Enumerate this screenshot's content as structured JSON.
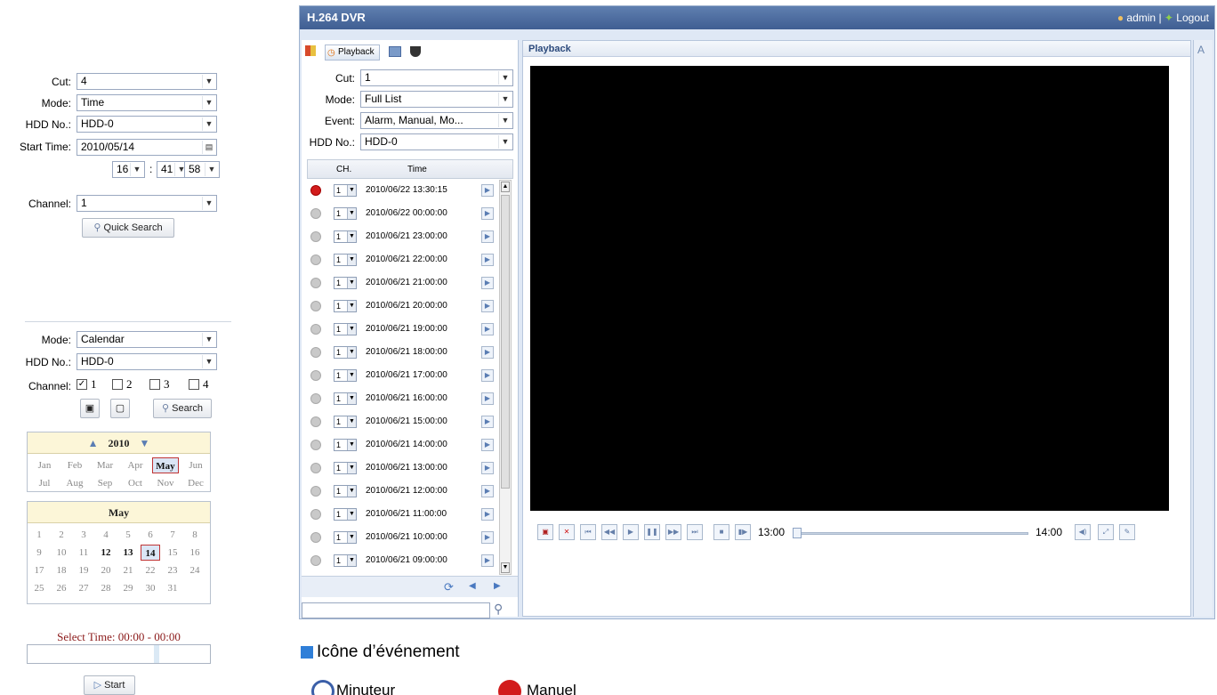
{
  "quick": {
    "cut_label": "Cut:",
    "cut_value": "4",
    "mode_label": "Mode:",
    "mode_value": "Time",
    "hdd_label": "HDD No.:",
    "hdd_value": "HDD-0",
    "start_label": "Start Time:",
    "start_value": "2010/05/14",
    "hour": "16",
    "minute": "41",
    "second": "58",
    "channel_label": "Channel:",
    "channel_value": "1",
    "search_button": "Quick Search"
  },
  "calsearch": {
    "mode_label": "Mode:",
    "mode_value": "Calendar",
    "hdd_label": "HDD No.:",
    "hdd_value": "HDD-0",
    "channel_label": "Channel:",
    "channels": [
      "1",
      "2",
      "3",
      "4"
    ],
    "channel_checked": [
      true,
      false,
      false,
      false
    ],
    "search_button": "Search",
    "year": "2010",
    "months": [
      "Jan",
      "Feb",
      "Mar",
      "Apr",
      "May",
      "Jun",
      "Jul",
      "Aug",
      "Sep",
      "Oct",
      "Nov",
      "Dec"
    ],
    "selected_month": "May",
    "month_title": "May",
    "days": [
      "1",
      "2",
      "3",
      "4",
      "5",
      "6",
      "7",
      "8",
      "9",
      "10",
      "11",
      "12",
      "13",
      "14",
      "15",
      "16",
      "17",
      "18",
      "19",
      "20",
      "21",
      "22",
      "23",
      "24",
      "25",
      "26",
      "27",
      "28",
      "29",
      "30",
      "31"
    ],
    "bold_days": [
      "12",
      "13",
      "14"
    ],
    "selected_day": "14",
    "select_time": "Select Time: 00:00 - 00:00",
    "start_button": "Start"
  },
  "dvr": {
    "title": "H.264 DVR",
    "user": "admin",
    "logout": "Logout",
    "tab_playback": "Playback",
    "cut_label": "Cut:",
    "cut_value": "1",
    "mode_label": "Mode:",
    "mode_value": "Full List",
    "event_label": "Event:",
    "event_value": "Alarm, Manual, Mo...",
    "hdd_label": "HDD No.:",
    "hdd_value": "HDD-0",
    "col_ch": "CH.",
    "col_time": "Time",
    "rows": [
      {
        "ch": "1",
        "time": "2010/06/22 13:30:15",
        "event": "manual"
      },
      {
        "ch": "1",
        "time": "2010/06/22 00:00:00",
        "event": "timer"
      },
      {
        "ch": "1",
        "time": "2010/06/21 23:00:00",
        "event": "timer"
      },
      {
        "ch": "1",
        "time": "2010/06/21 22:00:00",
        "event": "timer"
      },
      {
        "ch": "1",
        "time": "2010/06/21 21:00:00",
        "event": "timer"
      },
      {
        "ch": "1",
        "time": "2010/06/21 20:00:00",
        "event": "timer"
      },
      {
        "ch": "1",
        "time": "2010/06/21 19:00:00",
        "event": "timer"
      },
      {
        "ch": "1",
        "time": "2010/06/21 18:00:00",
        "event": "timer"
      },
      {
        "ch": "1",
        "time": "2010/06/21 17:00:00",
        "event": "timer"
      },
      {
        "ch": "1",
        "time": "2010/06/21 16:00:00",
        "event": "timer"
      },
      {
        "ch": "1",
        "time": "2010/06/21 15:00:00",
        "event": "timer"
      },
      {
        "ch": "1",
        "time": "2010/06/21 14:00:00",
        "event": "timer"
      },
      {
        "ch": "1",
        "time": "2010/06/21 13:00:00",
        "event": "timer"
      },
      {
        "ch": "1",
        "time": "2010/06/21 12:00:00",
        "event": "timer"
      },
      {
        "ch": "1",
        "time": "2010/06/21 11:00:00",
        "event": "timer"
      },
      {
        "ch": "1",
        "time": "2010/06/21 10:00:00",
        "event": "timer"
      },
      {
        "ch": "1",
        "time": "2010/06/21 09:00:00",
        "event": "timer"
      }
    ],
    "playback_title": "Playback",
    "time_start": "13:00",
    "time_end": "14:00"
  },
  "legend": {
    "title": "Icône d’événement",
    "timer": "Minuteur",
    "manual": "Manuel"
  },
  "colors": {
    "header": "#3f5e92",
    "manual_icon": "#d21c1c",
    "legend_square": "#2f7fd8"
  }
}
